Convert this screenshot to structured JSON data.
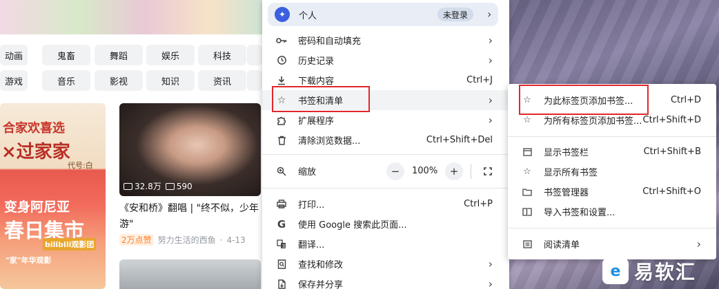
{
  "background": {
    "tags_row1": [
      "动画",
      "鬼畜",
      "舞蹈",
      "娱乐",
      "科技"
    ],
    "tags_row2": [
      "游戏",
      "音乐",
      "影视",
      "知识",
      "资讯"
    ],
    "left_card": {
      "line1": "合家欢喜选",
      "line2": "×过家家",
      "line3": "代号:白",
      "line4": "变身阿尼亚",
      "line5": "春日集市",
      "badge": "bilibili观影团",
      "line7": "\"家\"年华观影"
    },
    "video": {
      "views": "32.8万",
      "danmaku": "590",
      "title_line1": "《安和桥》翻唱 | \"终不似，少年",
      "title_line2": "游\"",
      "hot_tag": "2万点赞",
      "author": "努力生活的西鱼",
      "date": "4-13"
    }
  },
  "menu": {
    "profile": {
      "avatar_icon": "butterfly-icon",
      "name": "个人",
      "status": "未登录"
    },
    "items": [
      {
        "icon": "key-icon",
        "label": "密码和自动填充",
        "shortcut": "",
        "has_submenu": true
      },
      {
        "icon": "history-icon",
        "label": "历史记录",
        "shortcut": "",
        "has_submenu": true
      },
      {
        "icon": "download-icon",
        "label": "下载内容",
        "shortcut": "Ctrl+J",
        "has_submenu": false
      },
      {
        "icon": "star-icon",
        "label": "书签和清单",
        "shortcut": "",
        "has_submenu": true
      },
      {
        "icon": "puzzle-icon",
        "label": "扩展程序",
        "shortcut": "",
        "has_submenu": true
      },
      {
        "icon": "trash-icon",
        "label": "清除浏览数据...",
        "shortcut": "Ctrl+Shift+Del",
        "has_submenu": false
      }
    ],
    "zoom": {
      "label": "缩放",
      "minus": "−",
      "value": "100%",
      "plus": "+"
    },
    "items2": [
      {
        "icon": "print-icon",
        "label": "打印...",
        "shortcut": "Ctrl+P",
        "has_submenu": false
      },
      {
        "icon": "google-icon",
        "label": "使用 Google 搜索此页面...",
        "shortcut": "",
        "has_submenu": false
      },
      {
        "icon": "translate-icon",
        "label": "翻译...",
        "shortcut": "",
        "has_submenu": false
      },
      {
        "icon": "find-icon",
        "label": "查找和修改",
        "shortcut": "",
        "has_submenu": true
      },
      {
        "icon": "save-share-icon",
        "label": "保存并分享",
        "shortcut": "",
        "has_submenu": true
      }
    ]
  },
  "submenu": {
    "items": [
      {
        "icon": "star-outline-icon",
        "label": "为此标签页添加书签...",
        "shortcut": "Ctrl+D"
      },
      {
        "icon": "star-outline-icon",
        "label": "为所有标签页添加书签...",
        "shortcut": "Ctrl+Shift+D"
      }
    ],
    "items2": [
      {
        "icon": "bookmark-bar-icon",
        "label": "显示书签栏",
        "shortcut": "Ctrl+Shift+B"
      },
      {
        "icon": "star-filled-icon",
        "label": "显示所有书签",
        "shortcut": ""
      },
      {
        "icon": "bookmark-manager-icon",
        "label": "书签管理器",
        "shortcut": "Ctrl+Shift+O"
      },
      {
        "icon": "import-icon",
        "label": "导入书签和设置...",
        "shortcut": ""
      }
    ],
    "reading_list": {
      "icon": "reading-list-icon",
      "label": "阅读清单"
    }
  },
  "watermark": {
    "logo": "e",
    "text": "易软汇"
  },
  "colors": {
    "highlight_border": "#e0262b",
    "profile_bg": "#e9eef6"
  }
}
